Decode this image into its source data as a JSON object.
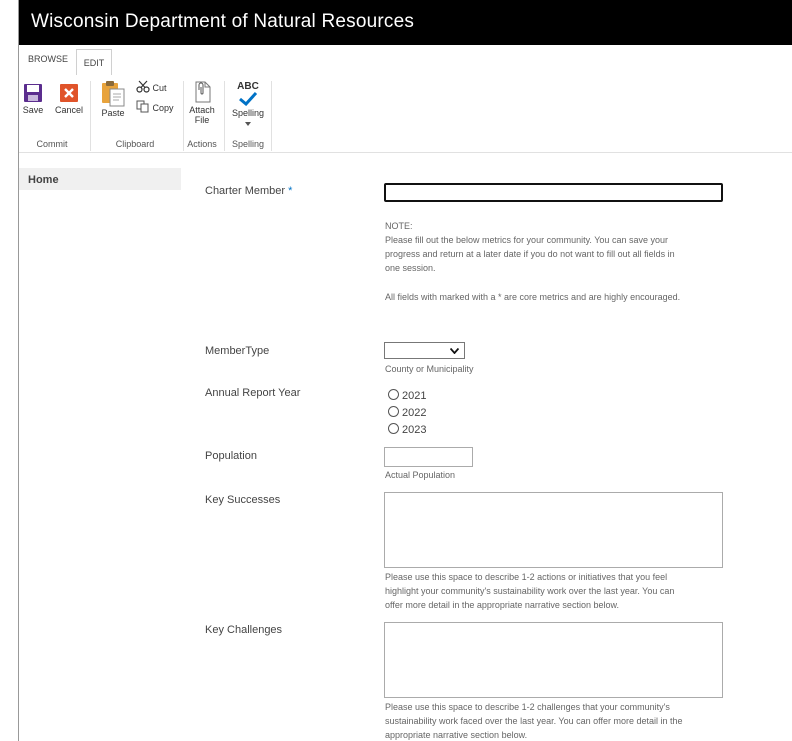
{
  "header": {
    "title": "Wisconsin Department of Natural Resources"
  },
  "tabs": {
    "browse": "BROWSE",
    "edit": "EDIT"
  },
  "ribbon": {
    "save": "Save",
    "cancel": "Cancel",
    "paste": "Paste",
    "cut": "Cut",
    "copy": "Copy",
    "attach_line1": "Attach",
    "attach_line2": "File",
    "spelling": "Spelling",
    "abc": "ABC",
    "groups": {
      "commit": "Commit",
      "clipboard": "Clipboard",
      "actions": "Actions",
      "spelling": "Spelling"
    },
    "colors": {
      "save": "#5b2d8e",
      "cancel": "#e0542a",
      "check": "#0072c6"
    }
  },
  "nav": {
    "home": "Home"
  },
  "form": {
    "charter_member": {
      "label": "Charter Member",
      "required_mark": "*",
      "value": ""
    },
    "note": {
      "title": "NOTE:",
      "line1": "Please fill out the below metrics for your community. You can save your",
      "line2": "progress and return at a later date if you do not want to fill out all fields in",
      "line3": "one session.",
      "line4": "All fields with marked with a * are core metrics and are highly encouraged."
    },
    "member_type": {
      "label": "MemberType",
      "hint": "County or Municipality",
      "selected": ""
    },
    "annual_report_year": {
      "label": "Annual Report Year",
      "options": [
        "2021",
        "2022",
        "2023"
      ]
    },
    "population": {
      "label": "Population",
      "hint": "Actual Population",
      "value": ""
    },
    "key_successes": {
      "label": "Key Successes",
      "value": "",
      "hint_line1": "Please use this space to describe 1-2 actions or initiatives that you feel",
      "hint_line2": "highlight your community's sustainability work over the last year. You can",
      "hint_line3": "offer more detail in the appropriate narrative section below."
    },
    "key_challenges": {
      "label": "Key Challenges",
      "value": "",
      "hint_line1": "Please use this space to describe 1-2 challenges that your community's",
      "hint_line2": "sustainability work faced over the last year. You can offer more detail in the",
      "hint_line3": "appropriate narrative section below."
    }
  }
}
